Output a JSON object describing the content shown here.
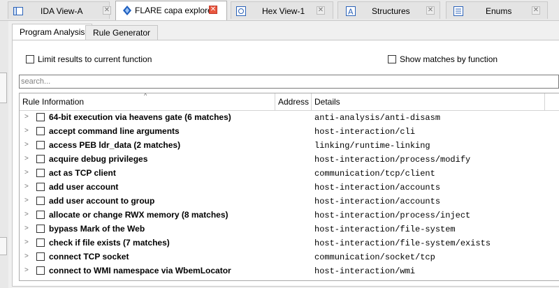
{
  "tabs": [
    {
      "label": "IDA View-A",
      "icon": "ida-view-icon",
      "active": false
    },
    {
      "label": "FLARE capa explorer",
      "icon": "flare-icon",
      "active": true
    },
    {
      "label": "Hex View-1",
      "icon": "hex-view-icon",
      "active": false
    },
    {
      "label": "Structures",
      "icon": "structures-icon",
      "active": false
    },
    {
      "label": "Enums",
      "icon": "enums-icon",
      "active": false
    }
  ],
  "close_glyph": "✕",
  "subtabs": [
    {
      "label": "Program Analysis",
      "active": true
    },
    {
      "label": "Rule Generator",
      "active": false
    }
  ],
  "options": {
    "limit_label": "Limit results to current function",
    "show_matches_label": "Show matches by function"
  },
  "search": {
    "placeholder": "search..."
  },
  "table": {
    "columns": [
      "Rule Information",
      "Address",
      "Details"
    ],
    "sort_glyph": "^",
    "expander_glyph": ">",
    "rows": [
      {
        "name": "64-bit execution via heavens gate (6 matches)",
        "address": "",
        "details": "anti-analysis/anti-disasm"
      },
      {
        "name": "accept command line arguments",
        "address": "",
        "details": "host-interaction/cli"
      },
      {
        "name": "access PEB ldr_data (2 matches)",
        "address": "",
        "details": "linking/runtime-linking"
      },
      {
        "name": "acquire debug privileges",
        "address": "",
        "details": "host-interaction/process/modify"
      },
      {
        "name": "act as TCP client",
        "address": "",
        "details": "communication/tcp/client"
      },
      {
        "name": "add user account",
        "address": "",
        "details": "host-interaction/accounts"
      },
      {
        "name": "add user account to group",
        "address": "",
        "details": "host-interaction/accounts"
      },
      {
        "name": "allocate or change RWX memory (8 matches)",
        "address": "",
        "details": "host-interaction/process/inject"
      },
      {
        "name": "bypass Mark of the Web",
        "address": "",
        "details": "host-interaction/file-system"
      },
      {
        "name": "check if file exists (7 matches)",
        "address": "",
        "details": "host-interaction/file-system/exists"
      },
      {
        "name": "connect TCP socket",
        "address": "",
        "details": "communication/socket/tcp"
      },
      {
        "name": "connect to WMI namespace via WbemLocator",
        "address": "",
        "details": "host-interaction/wmi"
      }
    ]
  },
  "colors": {
    "active_close": "#e9573f",
    "panel_bg": "#ffffff",
    "chrome_bg": "#f0f0f0"
  }
}
